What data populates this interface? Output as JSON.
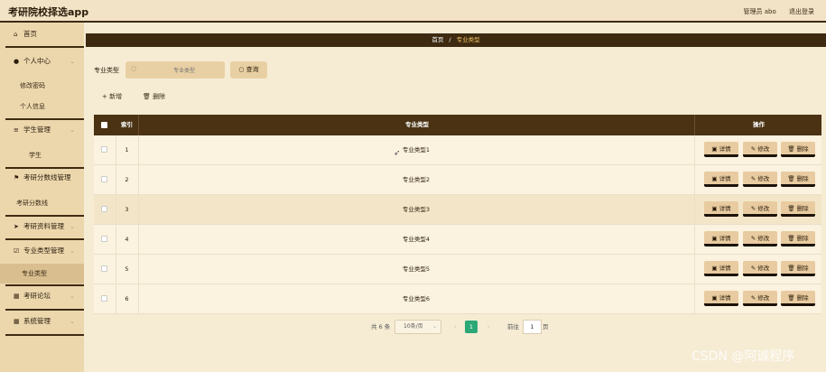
{
  "app": {
    "title": "考研院校择选app",
    "user": "管理员 abo",
    "logout": "退出登录"
  },
  "sidebar": {
    "home": "首页",
    "personal": "个人中心",
    "change_password": "修改密码",
    "personal_info": "个人信息",
    "student_mgmt": "学生管理",
    "student": "学生",
    "score_mgmt": "考研分数线管理",
    "score": "考研分数线",
    "material_mgmt": "考研资料管理",
    "major_mgmt": "专业类型管理",
    "major_type": "专业类型",
    "forum": "考研论坛",
    "system_mgmt": "系统管理"
  },
  "breadcrumb": {
    "home": "首页",
    "sep": "/",
    "current": "专业类型"
  },
  "filter": {
    "label": "专业类型",
    "placeholder": "专业类型",
    "query": "查询"
  },
  "actions": {
    "add": "新增",
    "delete": "删除"
  },
  "table": {
    "headers": {
      "index": "索引",
      "major_type": "专业类型",
      "operation": "操作"
    },
    "rows": [
      {
        "index": "1",
        "name": "专业类型1"
      },
      {
        "index": "2",
        "name": "专业类型2"
      },
      {
        "index": "3",
        "name": "专业类型3"
      },
      {
        "index": "4",
        "name": "专业类型4"
      },
      {
        "index": "5",
        "name": "专业类型5"
      },
      {
        "index": "6",
        "name": "专业类型6"
      }
    ],
    "ops": {
      "detail": "详情",
      "edit": "修改",
      "delete": "删除"
    }
  },
  "pagination": {
    "total": "共 6 条",
    "page_size": "10条/页",
    "current_page": "1",
    "goto": "前往",
    "goto_value": "1",
    "page_unit": "页"
  },
  "watermark": "CSDN @阿诚程序",
  "colors": {
    "dark_brown": "#3d2a11",
    "sidebar_bg": "#ecd7ad",
    "accent_green": "#2aa876",
    "button_tan": "#e8cba0"
  }
}
